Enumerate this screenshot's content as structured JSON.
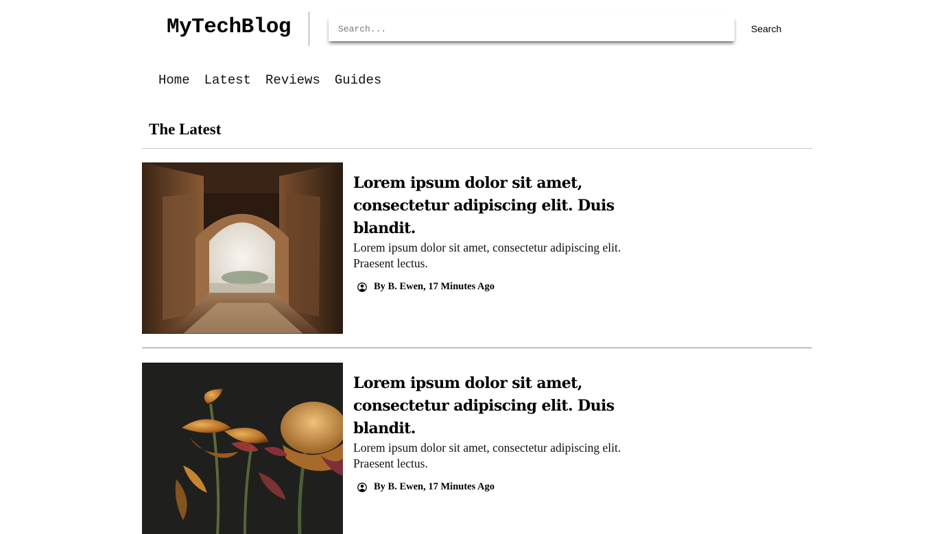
{
  "header": {
    "logo": "MyTechBlog",
    "search_placeholder": "Search...",
    "search_button": "Search"
  },
  "nav": [
    "Home",
    "Latest",
    "Reviews",
    "Guides"
  ],
  "section_title": "The Latest",
  "articles": [
    {
      "image": "archway-photo",
      "title": "Lorem ipsum dolor sit amet, consectetur adipiscing elit. Duis blandit.",
      "excerpt": "Lorem ipsum dolor sit amet, consectetur adipiscing elit. Praesent lectus.",
      "meta": "By B. Ewen, 17 Minutes Ago"
    },
    {
      "image": "flowers-photo",
      "title": "Lorem ipsum dolor sit amet, consectetur adipiscing elit. Duis blandit.",
      "excerpt": "Lorem ipsum dolor sit amet, consectetur adipiscing elit. Praesent lectus.",
      "meta": "By B. Ewen, 17 Minutes Ago"
    }
  ],
  "icons": {
    "author": "user-circle-icon"
  }
}
